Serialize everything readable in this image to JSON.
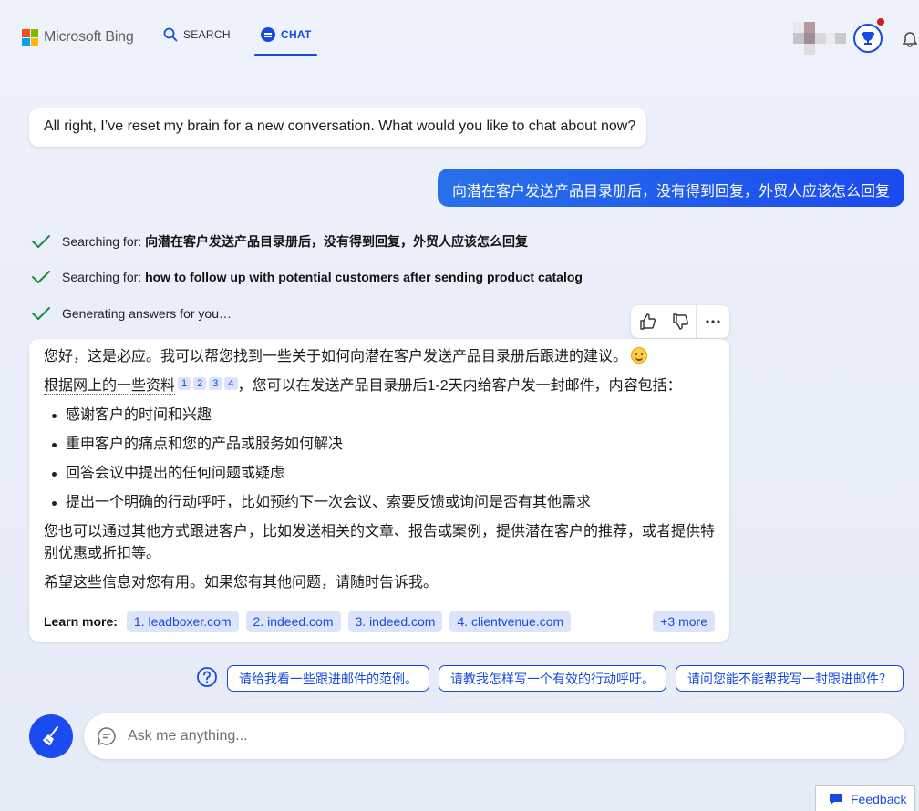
{
  "header": {
    "logo_text": "Microsoft Bing",
    "tabs": [
      {
        "label": "SEARCH",
        "icon": "search-icon"
      },
      {
        "label": "CHAT",
        "icon": "chat-bubble-icon",
        "active": true
      }
    ],
    "accent_color": "#174ae4"
  },
  "conversation": {
    "greeting": "All right, I’ve reset my brain for a new conversation. What would you like to chat about now?",
    "user_message": "向潜在客户发送产品目录册后，没有得到回复，外贸人应该怎么回复",
    "status": [
      {
        "prefix": "Searching for: ",
        "query": "向潜在客户发送产品目录册后，没有得到回复，外贸人应该怎么回复"
      },
      {
        "prefix": "Searching for: ",
        "query": "how to follow up with potential customers after sending product catalog"
      },
      {
        "prefix": "Generating answers for you…",
        "query": ""
      }
    ],
    "answer": {
      "intro": "您好，这是必应。我可以帮您找到一些关于如何向潜在客户发送产品目录册后跟进的建议。",
      "source_prefix": "根据网上的一些资料",
      "citations": [
        "1",
        "2",
        "3",
        "4"
      ],
      "source_suffix": "，您可以在发送产品目录册后1-2天内给客户发一封邮件，内容包括：",
      "bullets": [
        "感谢客户的时间和兴趣",
        "重申客户的痛点和您的产品或服务如何解决",
        "回答会议中提出的任何问题或疑虑",
        "提出一个明确的行动呼吁，比如预约下一次会议、索要反馈或询问是否有其他需求"
      ],
      "paragraph2": "您也可以通过其他方式跟进客户，比如发送相关的文章、报告或案例，提供潜在客户的推荐，或者提供特别优惠或折扣等。",
      "paragraph3": "希望这些信息对您有用。如果您有其他问题，请随时告诉我。"
    },
    "learn_more": {
      "label": "Learn more:",
      "links": [
        "1. leadboxer.com",
        "2. indeed.com",
        "3. indeed.com",
        "4. clientvenue.com"
      ],
      "more": "+3 more"
    }
  },
  "suggestions": [
    "请给我看一些跟进邮件的范例。",
    "请教我怎样写一个有效的行动呼吁。",
    "请问您能不能帮我写一封跟进邮件？"
  ],
  "input": {
    "placeholder": "Ask me anything..."
  },
  "footer": {
    "feedback_label": "Feedback"
  }
}
